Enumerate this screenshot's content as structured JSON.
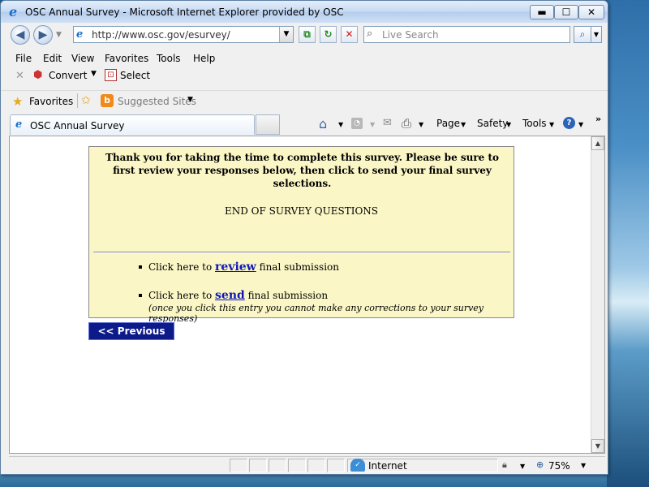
{
  "window": {
    "title": "OSC Annual Survey - Microsoft Internet Explorer provided by OSC",
    "min_glyph": "▬",
    "max_glyph": "☐",
    "close_glyph": "✕"
  },
  "address": {
    "url": "http://www.osc.gov/esurvey/",
    "search_placeholder": "Live Search"
  },
  "menu": [
    "File",
    "Edit",
    "View",
    "Favorites",
    "Tools",
    "Help"
  ],
  "toolbar": {
    "convert_label": "Convert",
    "select_label": "Select"
  },
  "favorites_bar": {
    "favorites_label": "Favorites",
    "suggested_label": "Suggested Sites"
  },
  "tab": {
    "title": "OSC Annual Survey"
  },
  "command_bar": {
    "page_label": "Page",
    "safety_label": "Safety",
    "tools_label": "Tools",
    "more_glyph": "»"
  },
  "survey": {
    "thanks_text": "Thank you for taking the time to complete this survey. Please be sure to first review your responses below, then click to send your final survey selections.",
    "end_text": "END OF SURVEY QUESTIONS",
    "review_prefix": "Click here to",
    "review_link": "review",
    "review_suffix": "final submission",
    "send_prefix": "Click here to",
    "send_link": "send",
    "send_suffix": "final submission",
    "send_note": "(once you click this entry you cannot make any corrections to your survey responses)",
    "previous_label": "<< Previous"
  },
  "status": {
    "zone_label": "Internet",
    "zoom_label": "75%"
  },
  "colors": {
    "survey_bg": "#faf6c5",
    "link": "#1018b8",
    "previous_button": "#0d1a8a"
  }
}
